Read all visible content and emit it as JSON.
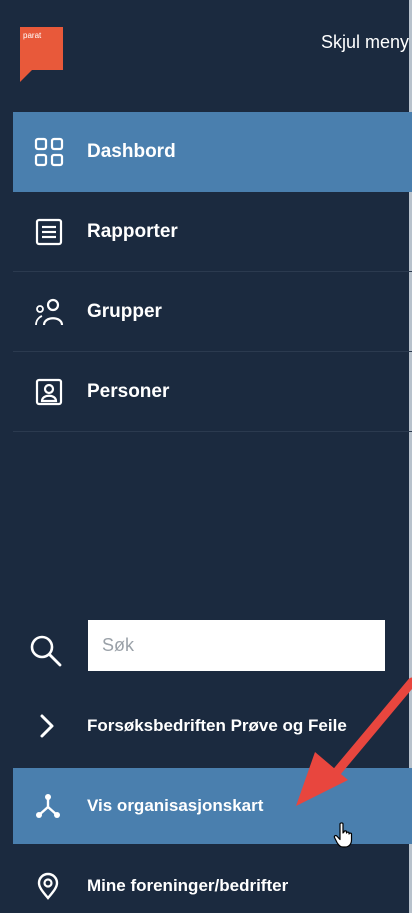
{
  "header": {
    "logo_text": "parat",
    "hide_menu_label": "Skjul meny"
  },
  "nav": {
    "items": [
      {
        "label": "Dashbord",
        "icon": "grid-icon",
        "active": true
      },
      {
        "label": "Rapporter",
        "icon": "document-list-icon",
        "active": false
      },
      {
        "label": "Grupper",
        "icon": "group-icon",
        "active": false
      },
      {
        "label": "Personer",
        "icon": "person-badge-icon",
        "active": false
      }
    ]
  },
  "search": {
    "placeholder": "Søk",
    "value": ""
  },
  "bottom_items": [
    {
      "label": "Forsøksbedriften Prøve og Feile",
      "icon": "chevron-right-icon",
      "active": false
    },
    {
      "label": "Vis organisasjonskart",
      "icon": "org-chart-icon",
      "active": true
    },
    {
      "label": "Mine foreninger/bedrifter",
      "icon": "location-pin-icon",
      "active": false
    }
  ],
  "colors": {
    "sidebar_bg": "#1b2a3f",
    "active_bg": "#4a7fae",
    "logo": "#e8593a",
    "annotation_arrow": "#e8463e"
  }
}
